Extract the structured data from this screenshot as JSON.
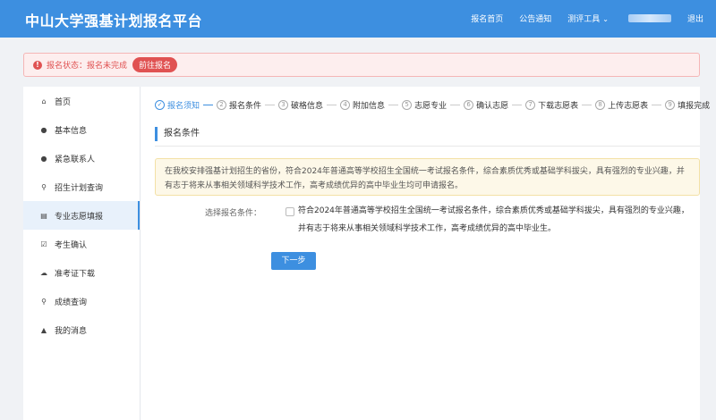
{
  "app": {
    "title": "中山大学强基计划报名平台"
  },
  "topnav": {
    "home": "报名首页",
    "notice": "公告通知",
    "tools": "测评工具",
    "logout": "退出"
  },
  "alert": {
    "text": "报名状态：报名未完成",
    "button": "前往报名"
  },
  "sidebar": {
    "items": [
      {
        "label": "首页",
        "icon": "home-icon"
      },
      {
        "label": "基本信息",
        "icon": "user-icon"
      },
      {
        "label": "紧急联系人",
        "icon": "user-icon"
      },
      {
        "label": "招生计划查询",
        "icon": "search-icon"
      },
      {
        "label": "专业志愿填报",
        "icon": "form-icon"
      },
      {
        "label": "考生确认",
        "icon": "check-icon"
      },
      {
        "label": "准考证下载",
        "icon": "cloud-download-icon"
      },
      {
        "label": "成绩查询",
        "icon": "search-icon"
      },
      {
        "label": "我的消息",
        "icon": "bell-icon"
      }
    ],
    "active_index": 4
  },
  "steps": [
    {
      "num": "✓",
      "label": "报名须知"
    },
    {
      "num": "2",
      "label": "报名条件"
    },
    {
      "num": "3",
      "label": "破格信息"
    },
    {
      "num": "4",
      "label": "附加信息"
    },
    {
      "num": "5",
      "label": "志愿专业"
    },
    {
      "num": "6",
      "label": "确认志愿"
    },
    {
      "num": "7",
      "label": "下载志愿表"
    },
    {
      "num": "8",
      "label": "上传志愿表"
    },
    {
      "num": "9",
      "label": "填报完成"
    }
  ],
  "section": {
    "title": "报名条件"
  },
  "notice": {
    "text": "在我校安排强基计划招生的省份，符合2024年普通高等学校招生全国统一考试报名条件，综合素质优秀或基础学科拔尖，具有强烈的专业兴趣，并有志于将来从事相关领域科学技术工作，高考成绩优异的高中毕业生均可申请报名。"
  },
  "form": {
    "label": "选择报名条件：",
    "option_text": "符合2024年普通高等学校招生全国统一考试报名条件，综合素质优秀或基础学科拔尖，具有强烈的专业兴趣，并有志于将来从事相关领域科学技术工作，高考成绩优异的高中毕业生。",
    "checked": false
  },
  "buttons": {
    "next": "下一步"
  },
  "colors": {
    "primary": "#3d8fe0",
    "danger": "#e05252",
    "notice_bg": "#fdf8e8"
  }
}
